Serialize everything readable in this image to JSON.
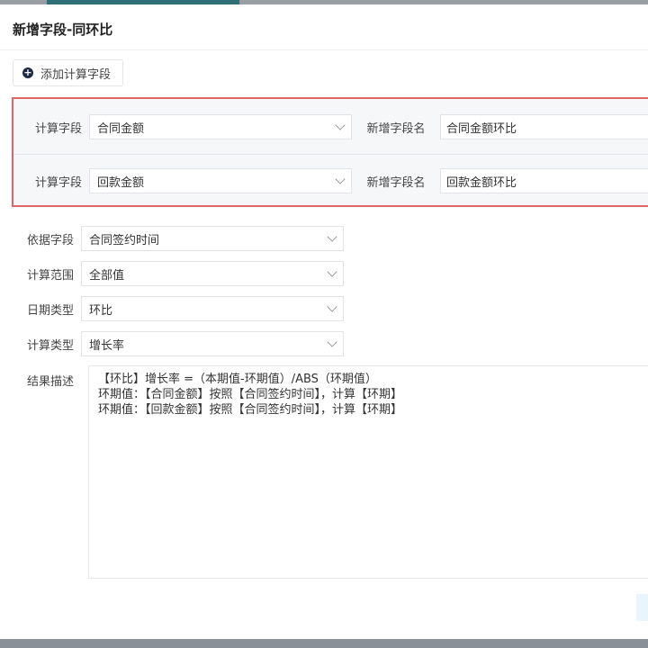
{
  "dialog": {
    "title": "新增字段-同环比",
    "add_button": "添加计算字段"
  },
  "calc_rows": [
    {
      "label": "计算字段",
      "value": "合同金额",
      "name_label": "新增字段名",
      "name_value": "合同金额环比"
    },
    {
      "label": "计算字段",
      "value": "回款金额",
      "name_label": "新增字段名",
      "name_value": "回款金额环比"
    }
  ],
  "fields": [
    {
      "label": "依据字段",
      "value": "合同签约时间"
    },
    {
      "label": "计算范围",
      "value": "全部值"
    },
    {
      "label": "日期类型",
      "value": "环比"
    },
    {
      "label": "计算类型",
      "value": "增长率"
    }
  ],
  "result": {
    "label": "结果描述",
    "lines": [
      "【环比】增长率 =（本期值-环期值）/ABS（环期值）",
      "环期值：【合同金额】按照【合同签约时间】，计算【环期】",
      "环期值：【回款金额】按照【合同签约时间】，计算【环期】"
    ]
  }
}
